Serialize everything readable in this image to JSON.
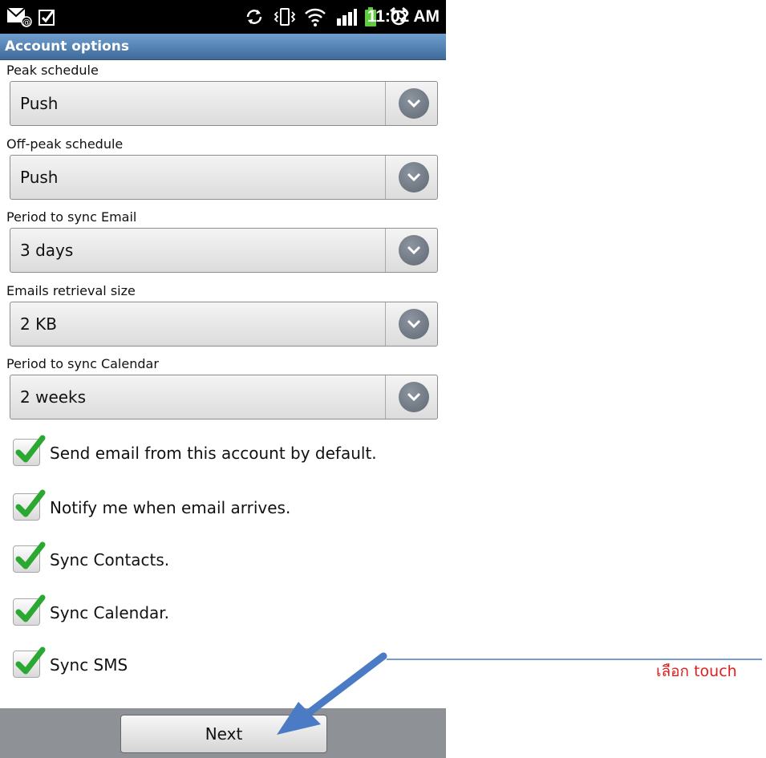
{
  "statusbar": {
    "time": "11:02 AM",
    "icons": [
      "email-notification-icon",
      "task-check-icon",
      "sync-icon",
      "vibrate-icon",
      "wifi-icon",
      "signal-icon",
      "battery-icon",
      "alarm-icon"
    ]
  },
  "title": "Account options",
  "fields": [
    {
      "label": "Peak schedule",
      "value": "Push"
    },
    {
      "label": "Off-peak schedule",
      "value": "Push"
    },
    {
      "label": "Period to sync Email",
      "value": "3 days"
    },
    {
      "label": "Emails retrieval size",
      "value": "2 KB"
    },
    {
      "label": "Period to sync Calendar",
      "value": "2 weeks"
    }
  ],
  "checkboxes": [
    {
      "label": "Send email from this account by default.",
      "checked": true
    },
    {
      "label": "Notify me when email arrives.",
      "checked": true
    },
    {
      "label": "Sync Contacts.",
      "checked": true
    },
    {
      "label": "Sync Calendar.",
      "checked": true
    },
    {
      "label": "Sync SMS",
      "checked": true
    }
  ],
  "next_label": "Next",
  "annotation": {
    "text": "เลือก touch",
    "color": "#e02020",
    "arrow_color": "#4a7bc4"
  },
  "colors": {
    "titlebar": "#4f7fb0",
    "check_green": "#2aa832"
  }
}
